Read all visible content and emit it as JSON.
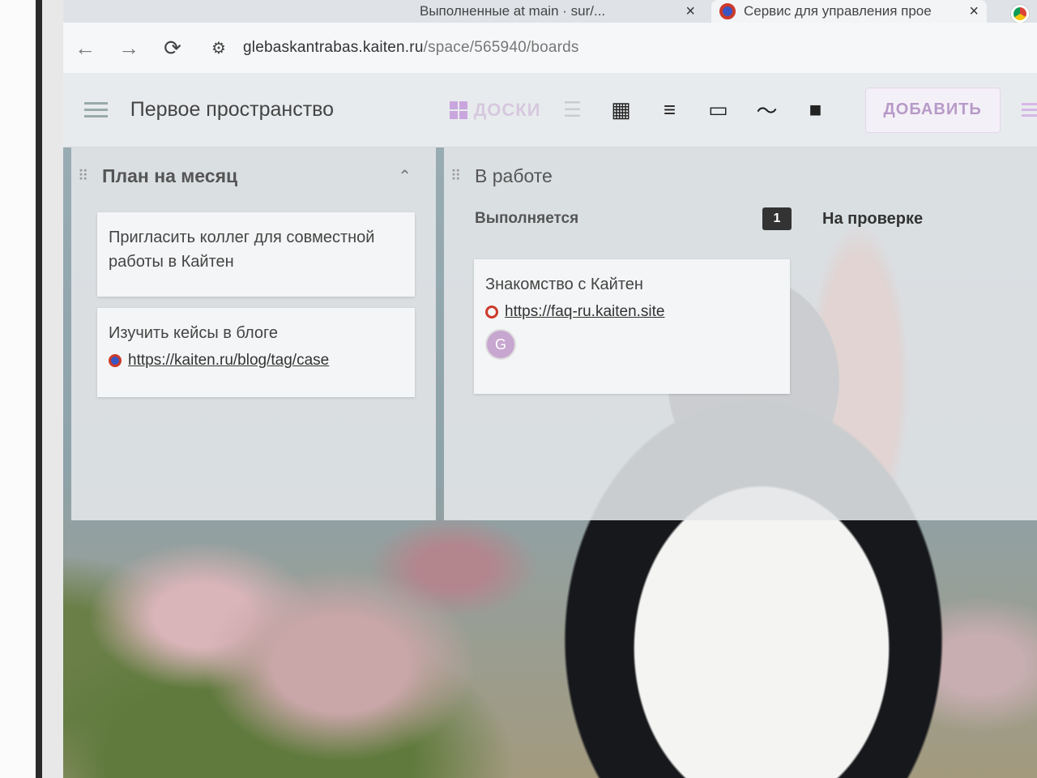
{
  "browser": {
    "tabs": [
      {
        "title": "Выполненные at main · sur/...",
        "close_icon": "×"
      },
      {
        "title": "Сервис для управления прое",
        "close_icon": "×"
      }
    ],
    "url_host": "glebaskantrabas.kaiten.ru",
    "url_path": "/space/565940/boards",
    "nav": {
      "back": "←",
      "forward": "→",
      "reload": "⟳",
      "site_info": "⚙"
    }
  },
  "header": {
    "space_title": "Первое пространство",
    "view_tab_label": "ДОСКИ",
    "view_icons": {
      "list": "☰",
      "table": "▦",
      "timeline": "≡",
      "calendar": "▭",
      "chart": "〜",
      "archive": "■"
    },
    "add_button": "ДОБАВИТЬ"
  },
  "columns": [
    {
      "title": "План на месяц",
      "collapse_icon": "⌃",
      "drag_icon": "⠿",
      "cards": [
        {
          "title": "Пригласить коллег для совместной работы в Кайтен"
        },
        {
          "title": "Изучить кейсы в блоге",
          "link": "https://kaiten.ru/blog/tag/case"
        }
      ]
    },
    {
      "title": "В работе",
      "drag_icon": "⠿",
      "subcolumns": [
        {
          "title": "Выполняется",
          "count": "1"
        },
        {
          "title": "На проверке"
        }
      ],
      "cards": [
        {
          "title": "Знакомство с Кайтен",
          "link": "https://faq-ru.kaiten.site",
          "avatar": "G"
        }
      ]
    }
  ]
}
